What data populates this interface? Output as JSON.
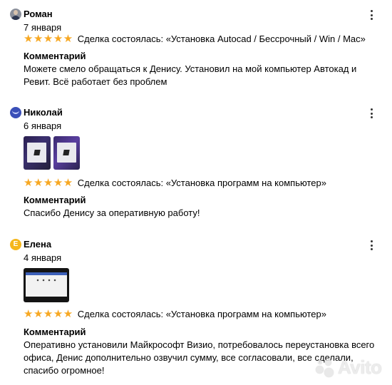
{
  "reviews": [
    {
      "name": "Роман",
      "date": "7 января",
      "stars": "★★★★★",
      "rating": 5,
      "deal": "Сделка состоялась: «Установка Autocad / Бессрочный / Win / Mac»",
      "comment_label": "Комментарий",
      "comment": "Можете смело обращаться к Денису. Установил на мой компьютер Автокад и Ревит. Всё работает без проблем"
    },
    {
      "name": "Николай",
      "date": "6 января",
      "stars": "★★★★★",
      "rating": 5,
      "deal": "Сделка состоялась: «Установка программ на компьютер»",
      "comment_label": "Комментарий",
      "comment": "Спасибо Денису за оперативную работу!"
    },
    {
      "name": "Елена",
      "avatar_letter": "Е",
      "date": "4 января",
      "stars": "★★★★★",
      "rating": 5,
      "deal": "Сделка состоялась: «Установка программ на компьютер»",
      "comment_label": "Комментарий",
      "comment": "Оперативно установили Майкрософт Визио, потребовалось переустановка всего офиса, Денис дополнительно озвучил сумму, все согласовали, все сделали, спасибо огромное!"
    }
  ],
  "icons": {
    "menu": "more-vertical-icon",
    "star": "star-icon"
  },
  "colors": {
    "star": "#f7a823",
    "avatar_blue": "#3a4fb8",
    "avatar_yellow": "#f5b71b"
  },
  "watermark": {
    "text": "Avito"
  }
}
